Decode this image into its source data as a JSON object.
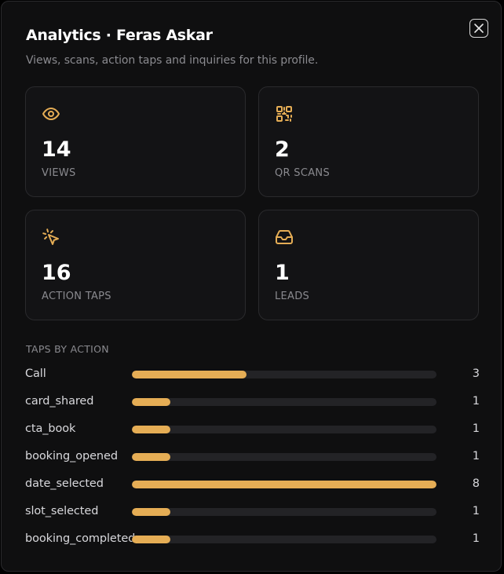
{
  "header": {
    "title": "Analytics · Feras Askar",
    "subtitle": "Views, scans, action taps and inquiries for this profile."
  },
  "stats": [
    {
      "icon": "eye-icon",
      "value": "14",
      "label": "VIEWS"
    },
    {
      "icon": "qr-code-icon",
      "value": "2",
      "label": "QR SCANS"
    },
    {
      "icon": "pointer-click-icon",
      "value": "16",
      "label": "ACTION TAPS"
    },
    {
      "icon": "inbox-icon",
      "value": "1",
      "label": "LEADS"
    }
  ],
  "taps": {
    "title": "TAPS BY ACTION",
    "rows": [
      {
        "label": "Call",
        "count": 3,
        "fraction": 0.375
      },
      {
        "label": "card_shared",
        "count": 1,
        "fraction": 0.125
      },
      {
        "label": "cta_book",
        "count": 1,
        "fraction": 0.125
      },
      {
        "label": "booking_opened",
        "count": 1,
        "fraction": 0.125
      },
      {
        "label": "date_selected",
        "count": 8,
        "fraction": 1.0
      },
      {
        "label": "slot_selected",
        "count": 1,
        "fraction": 0.125
      },
      {
        "label": "booking_completed",
        "count": 1,
        "fraction": 0.125
      }
    ]
  },
  "colors": {
    "accent": "#e5ad55",
    "background": "#0f0f10",
    "card": "#131315",
    "muted": "#8a8a8f"
  }
}
